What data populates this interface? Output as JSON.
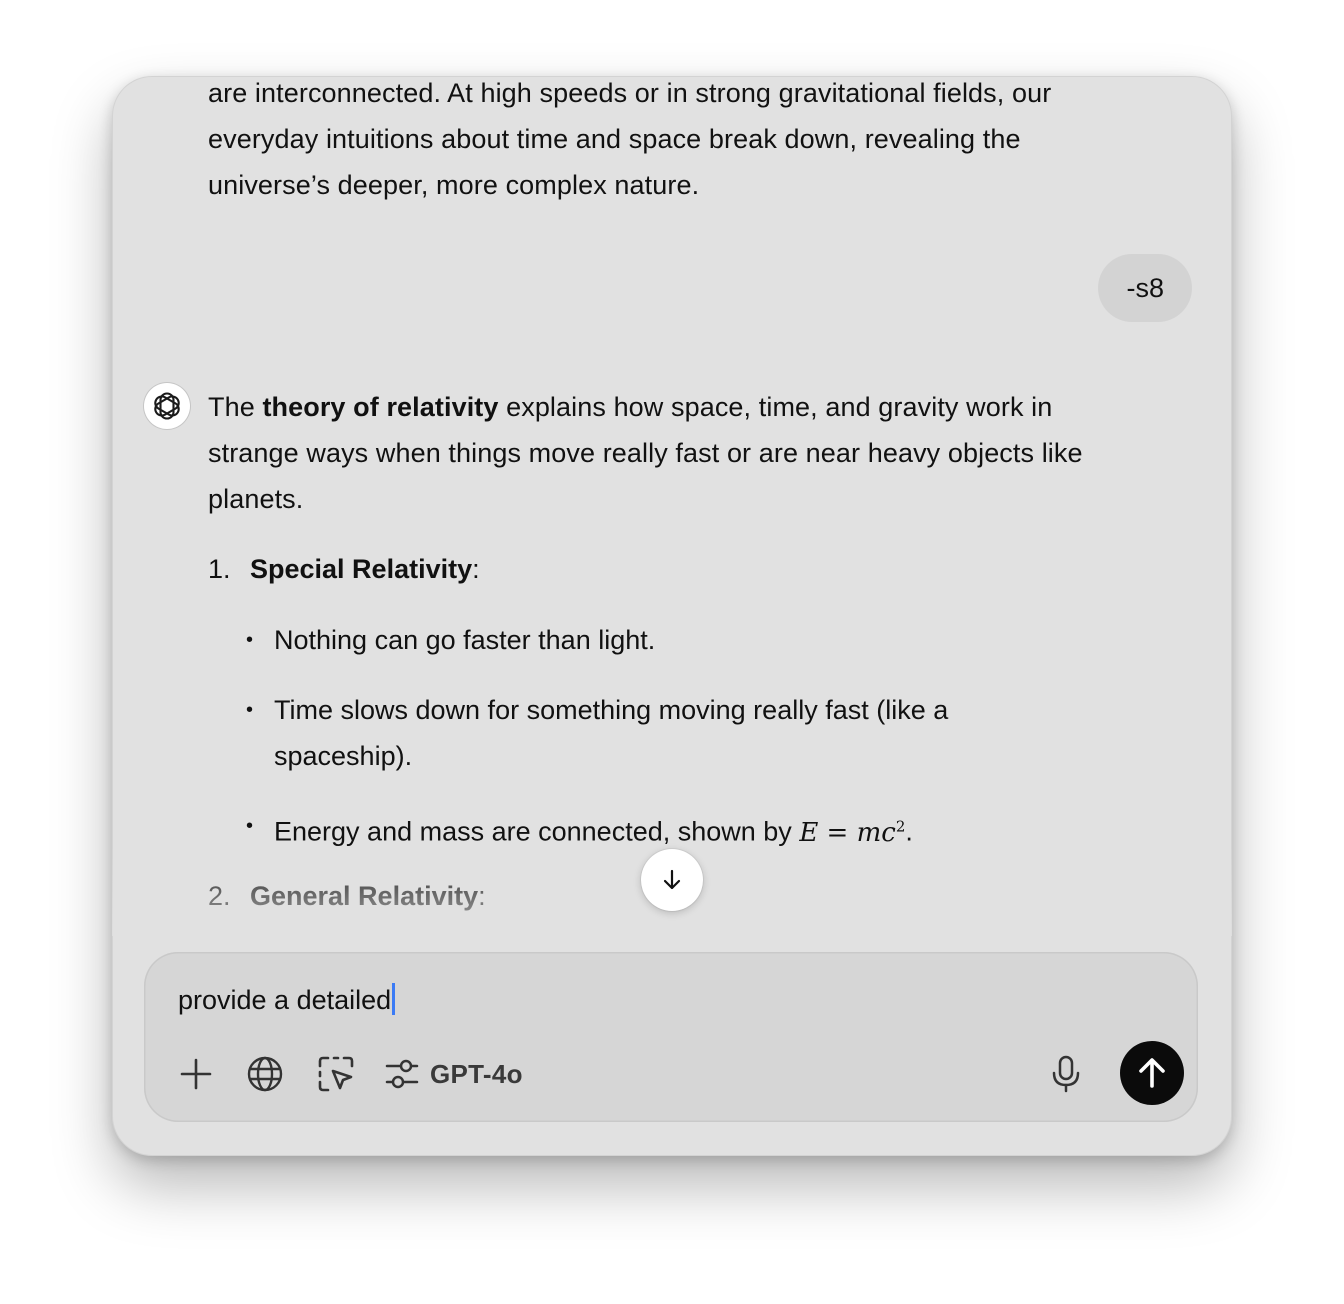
{
  "conversation": {
    "previous_message": "are interconnected. At high speeds or in strong gravitational fields, our everyday intuitions about time and space break down, revealing the universe’s deeper, more complex nature.",
    "user_message": "-s8",
    "assistant": {
      "intro_pre": "The ",
      "intro_bold": "theory of relativity",
      "intro_post": " explains how space, time, and gravity work in strange ways when things move really fast or are near heavy objects like planets.",
      "sections": [
        {
          "number": "1.",
          "title": "Special Relativity",
          "suffix": ":",
          "bullets": [
            "Nothing can go faster than light.",
            "Time slows down for something moving really fast (like a spaceship).",
            "Energy and mass are connected, shown by "
          ],
          "formula_base": "E = mc",
          "formula_exp": "2",
          "formula_end": "."
        },
        {
          "number": "2.",
          "title": "General Relativity",
          "suffix": ":"
        }
      ],
      "bullet_glyph": "•"
    }
  },
  "scroll_button": {
    "icon": "arrow-down-icon"
  },
  "composer": {
    "input_value": "provide a detailed",
    "tools": {
      "attach_icon": "plus-icon",
      "search_icon": "globe-icon",
      "select_icon": "dashed-select-cursor-icon",
      "model_icon": "sliders-icon",
      "model_label": "GPT-4o",
      "voice_icon": "microphone-icon",
      "send_icon": "arrow-up-icon"
    }
  },
  "colors": {
    "window_bg": "#e1e1e1",
    "composer_bg": "#d6d6d6",
    "user_bubble_bg": "#d3d3d3",
    "send_button_bg": "#0b0b0b",
    "caret": "#3b7bf5"
  }
}
